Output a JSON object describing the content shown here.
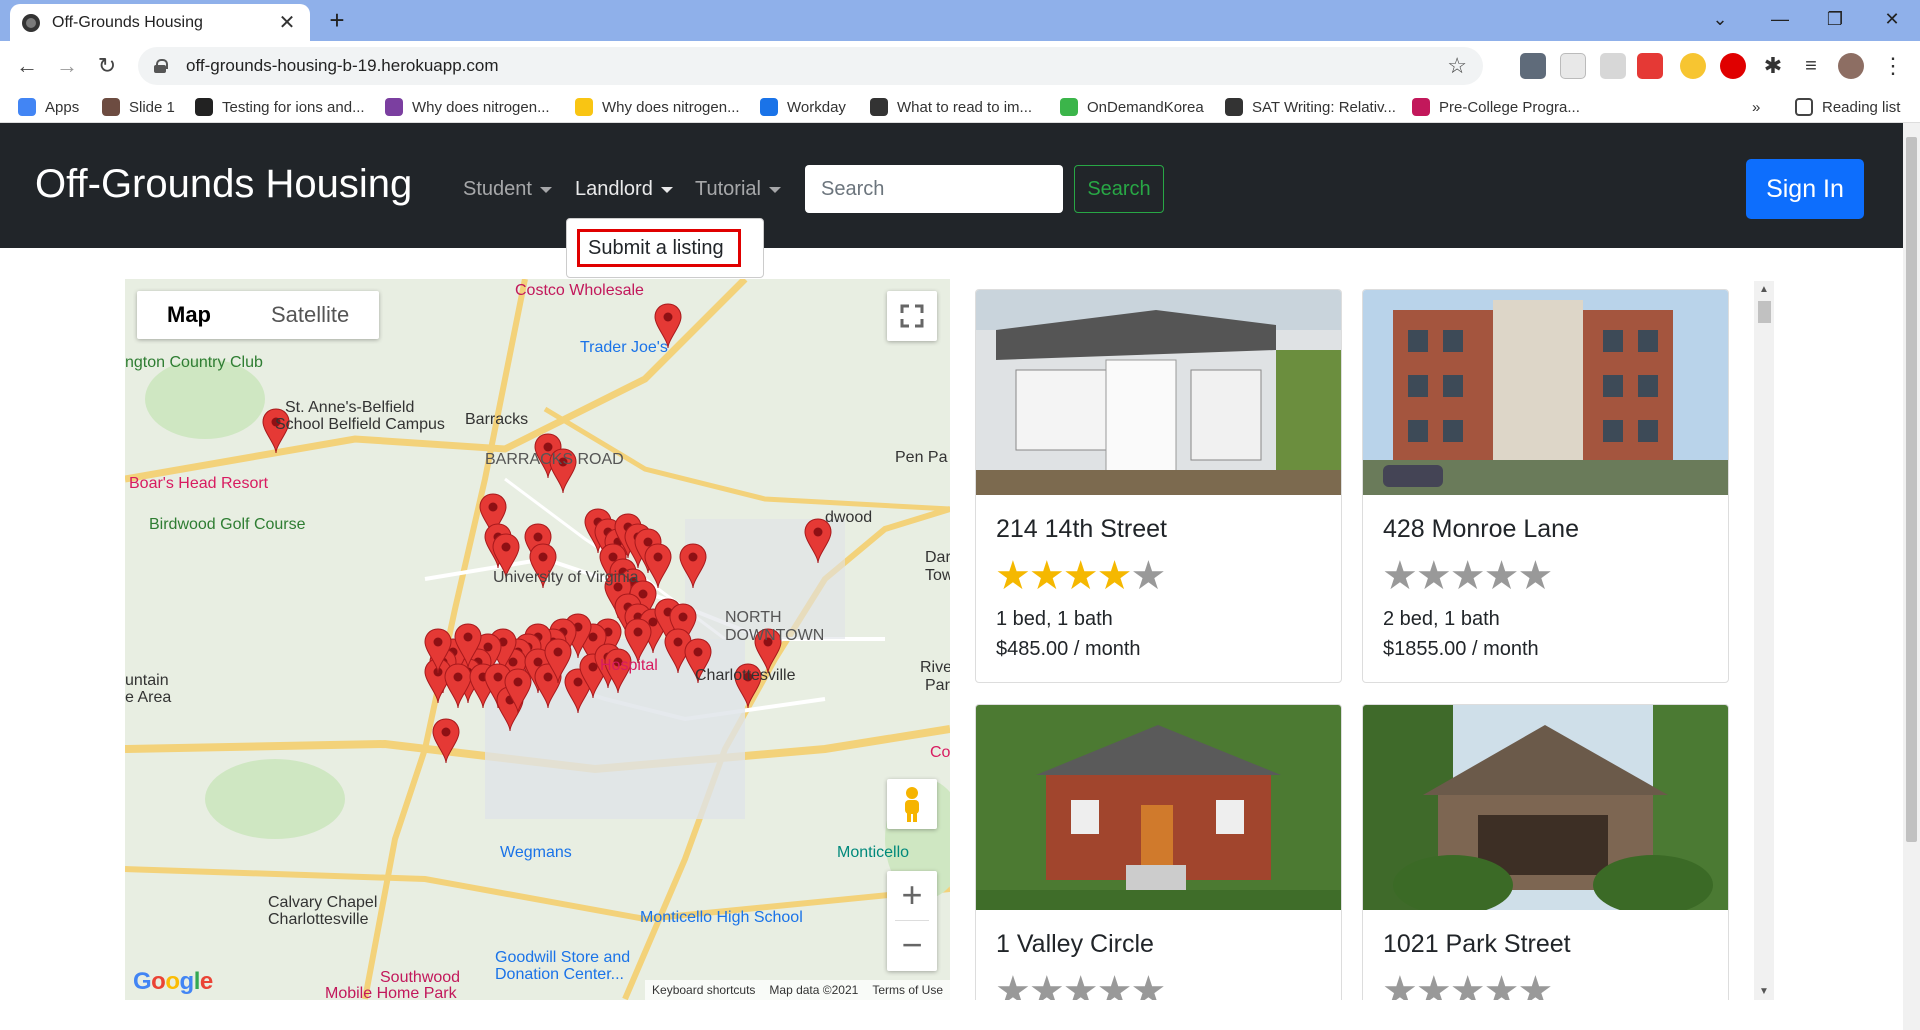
{
  "browser": {
    "tab_title": "Off-Grounds Housing",
    "new_tab": "+",
    "url": "off-grounds-housing-b-19.herokuapp.com",
    "reading_list": "Reading list",
    "bookmarks_overflow": "»",
    "bookmarks": [
      {
        "label": "Apps",
        "color": "#4285f4"
      },
      {
        "label": "Slide 1",
        "color": "#6d4c41"
      },
      {
        "label": "Testing for ions and...",
        "color": "#222222"
      },
      {
        "label": "Why does nitrogen...",
        "color": "#7b3fa0"
      },
      {
        "label": "Why does nitrogen...",
        "color": "#f9c513"
      },
      {
        "label": "Workday",
        "color": "#1a73e8"
      },
      {
        "label": "What to read to im...",
        "color": "#333333"
      },
      {
        "label": "OnDemandKorea",
        "color": "#3bb54a"
      },
      {
        "label": "SAT Writing: Relativ...",
        "color": "#333333"
      },
      {
        "label": "Pre-College Progra...",
        "color": "#c2185b"
      }
    ]
  },
  "navbar": {
    "brand": "Off-Grounds Housing",
    "menus": [
      "Student",
      "Landlord",
      "Tutorial"
    ],
    "search_placeholder": "Search",
    "search_button": "Search",
    "signin_button": "Sign In",
    "dropdown_item": "Submit a listing"
  },
  "map": {
    "type_map": "Map",
    "type_satellite": "Satellite",
    "labels": [
      "Costco Wholesale",
      "Trader Joe's",
      "ngton Country Club",
      "St. Anne's-Belfield",
      "School Belfield Campus",
      "Barracks",
      "BARRACKS ROAD",
      "Pen Pa",
      "dwood",
      "Boar's Head Resort",
      "Birdwood Golf Course",
      "University of Virginia",
      "NORTH",
      "DOWNTOWN",
      "Charlottesville",
      "Dar",
      "Towe",
      "Riverview",
      "Park",
      "untain",
      "e Area",
      "Wegmans",
      "Monticello",
      "Calvary Chapel",
      "Charlottesville",
      "Monticello High School",
      "Goodwill Store and",
      "Donation Center...",
      "Southwood",
      "Mobile Home Park",
      "Hospital",
      "Co"
    ],
    "footer_shortcuts": "Keyboard shortcuts",
    "footer_data": "Map data ©2021",
    "footer_terms": "Terms of Use",
    "google": "Google"
  },
  "listings": [
    {
      "title": "214 14th Street",
      "rating": 4,
      "beds": "1 bed, 1 bath",
      "price": "$485.00 / month"
    },
    {
      "title": "428 Monroe Lane",
      "rating": 0,
      "beds": "2 bed, 1 bath",
      "price": "$1855.00 / month"
    },
    {
      "title": "1 Valley Circle",
      "rating": 0,
      "beds": "",
      "price": ""
    },
    {
      "title": "1021 Park Street",
      "rating": 0,
      "beds": "",
      "price": ""
    }
  ]
}
